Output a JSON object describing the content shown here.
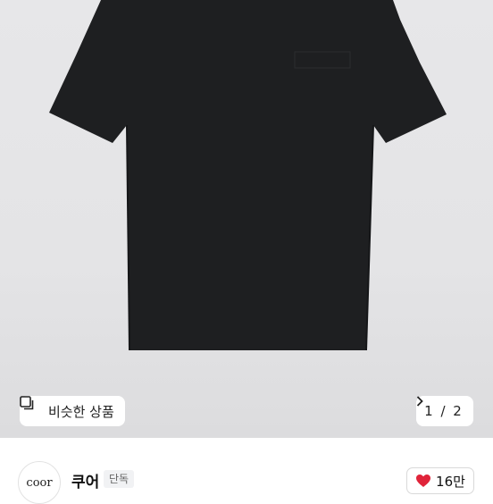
{
  "gallery": {
    "similar_label": "비슷한 상품",
    "similar_icon": "similar-products-icon",
    "page_current": "1",
    "page_separator": " / ",
    "page_total": "2",
    "next_icon": "chevron-right-icon"
  },
  "brand": {
    "logo_text": "coor",
    "name": "쿠어",
    "badge": "단독"
  },
  "like": {
    "icon": "heart-icon",
    "count": "16만",
    "color": "#e0243a"
  },
  "product": {
    "shirt_color": "#1d1e20",
    "background_color": "#e6e6e8"
  }
}
